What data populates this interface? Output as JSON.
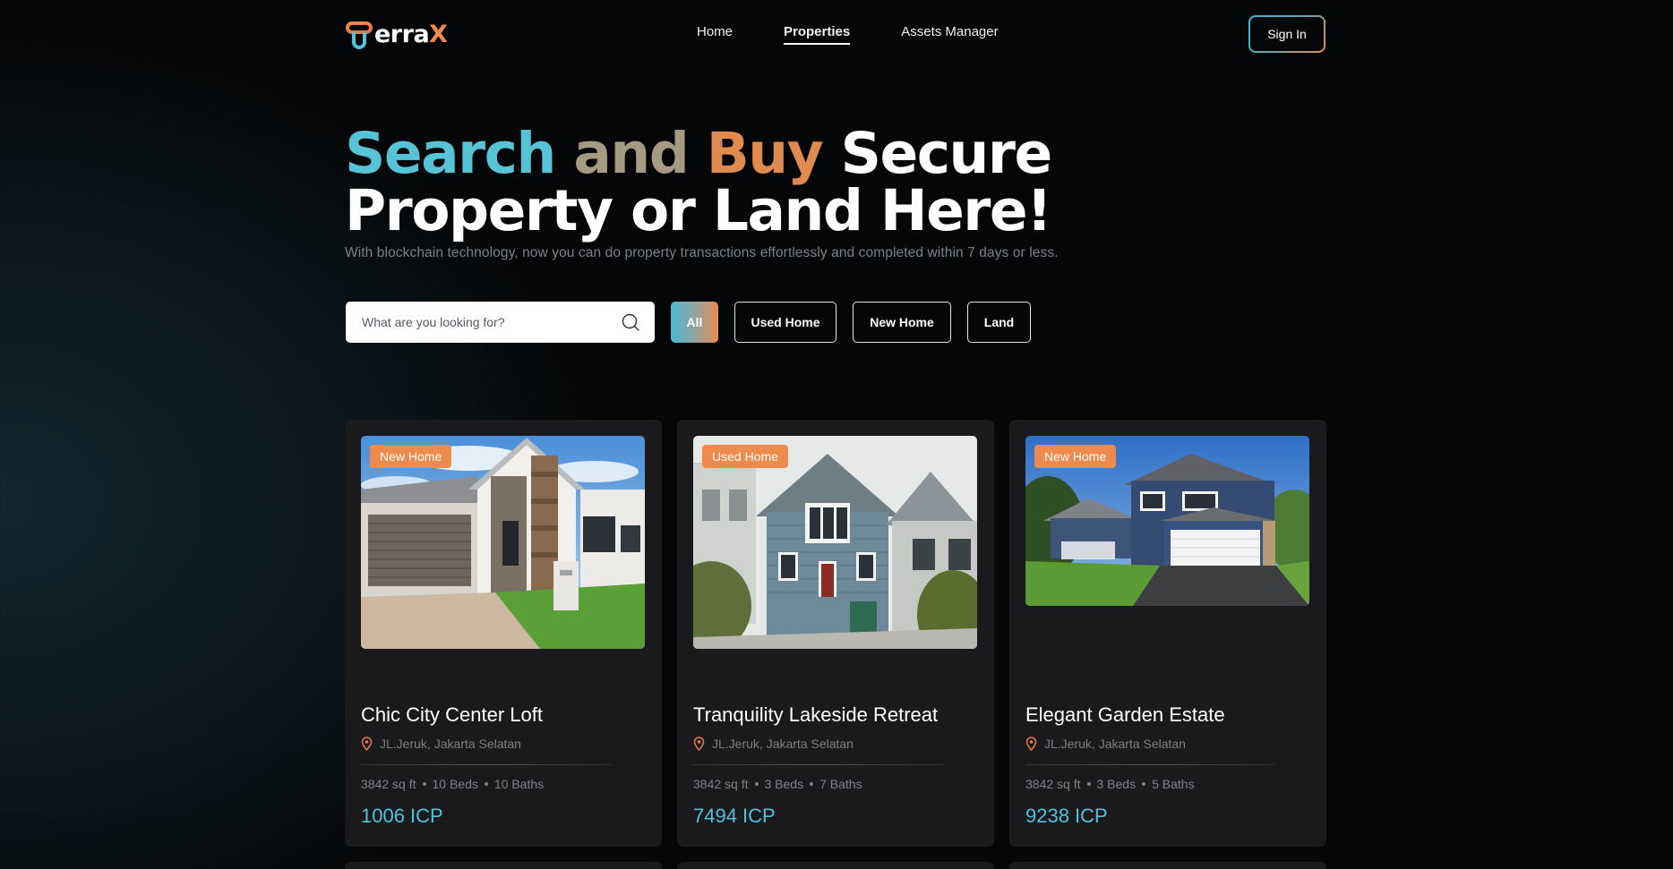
{
  "nav": {
    "logo_main": "erra",
    "logo_tail": "X",
    "links": [
      "Home",
      "Properties",
      "Assets Manager"
    ],
    "active_link": "Properties",
    "signin_label": "Sign In"
  },
  "hero": {
    "title_word1": "Search",
    "title_word2": "and",
    "title_word3": "Buy",
    "title_word4": "Secure",
    "title_line2": "Property or Land Here!",
    "subtitle": "With blockchain technology, now you can do property transactions effortlessly and completed within 7 days or less."
  },
  "search": {
    "placeholder": "What are you looking for?",
    "value": ""
  },
  "filters": [
    "All",
    "Used Home",
    "New Home",
    "Land"
  ],
  "active_filter": "All",
  "colors": {
    "accent_teal": "#4fc3dd",
    "accent_orange": "#ee8a4b",
    "card_bg": "#1a1a1c"
  },
  "properties": [
    {
      "badge": "New Home",
      "title": "Chic City Center Loft",
      "location": "JL.Jeruk, Jakarta Selatan",
      "sqft": "3842 sq ft",
      "beds": "10 Beds",
      "baths": "10 Baths",
      "price": "1006 ICP"
    },
    {
      "badge": "Used Home",
      "title": "Tranquility Lakeside Retreat",
      "location": "JL.Jeruk, Jakarta Selatan",
      "sqft": "3842 sq ft",
      "beds": "3 Beds",
      "baths": "7 Baths",
      "price": "7494 ICP"
    },
    {
      "badge": "New Home",
      "title": "Elegant Garden Estate",
      "location": "JL.Jeruk, Jakarta Selatan",
      "sqft": "3842 sq ft",
      "beds": "3 Beds",
      "baths": "5 Baths",
      "price": "9238 ICP"
    }
  ]
}
